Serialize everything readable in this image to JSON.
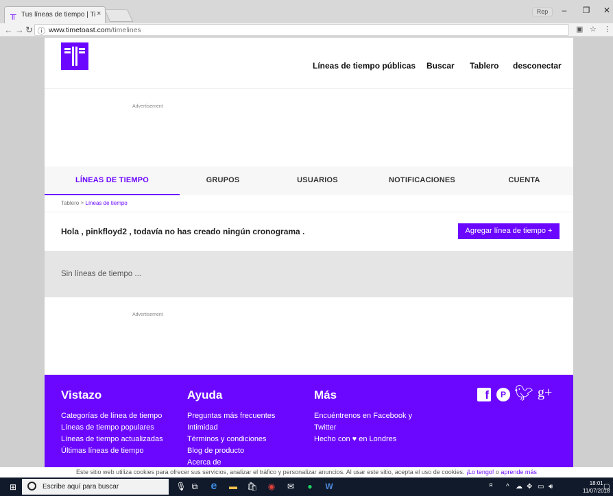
{
  "browser": {
    "tab_title": "Tus líneas de tiempo | Tim",
    "tab_close": "×",
    "profile_label": "Rep",
    "url_host": "www.timetoast.com",
    "url_path": "/timelines"
  },
  "header": {
    "nav": [
      "Líneas de tiempo públicas",
      "Buscar",
      "Tablero",
      "desconectar"
    ]
  },
  "ads": {
    "label": "Advertisement"
  },
  "tabs": [
    {
      "label": "LÍNEAS DE TIEMPO",
      "active": true
    },
    {
      "label": "GRUPOS"
    },
    {
      "label": "USUARIOS"
    },
    {
      "label": "NOTIFICACIONES"
    },
    {
      "label": "CUENTA"
    }
  ],
  "breadcrumb": {
    "root": "Tablero",
    "sep": " > ",
    "current": "Líneas de tiempo"
  },
  "main": {
    "greeting": "Hola , pinkfloyd2 , todavía no has creado ningún cronograma .",
    "add_button": "Agregar línea de tiempo +",
    "empty": "Sin líneas de tiempo ..."
  },
  "footer": {
    "columns": [
      {
        "title": "Vistazo",
        "links": [
          "Categorías de línea de tiempo",
          "Líneas de tiempo populares",
          "Líneas de tiempo actualizadas",
          "Últimas líneas de tiempo"
        ]
      },
      {
        "title": "Ayuda",
        "links": [
          "Preguntas más frecuentes",
          "Intimidad",
          "Términos y condiciones",
          "Blog de producto",
          "Acerca de"
        ]
      },
      {
        "title": "Más",
        "links": [
          "Encuéntrenos en Facebook y",
          "Twitter",
          "Hecho con ♥ en Londres"
        ]
      }
    ]
  },
  "cookie": {
    "text": "Este sitio web utiliza cookies para ofrecer sus servicios, analizar el tráfico y personalizar anuncios. Al usar este sitio, acepta el uso de cookies.",
    "accept": "¡Lo tengo!",
    "or": " o ",
    "learn": "aprende más"
  },
  "taskbar": {
    "search_placeholder": "Escribe aquí para buscar",
    "time": "18:01",
    "date": "11/07/2018"
  },
  "colors": {
    "brand": "#6b07ff"
  }
}
